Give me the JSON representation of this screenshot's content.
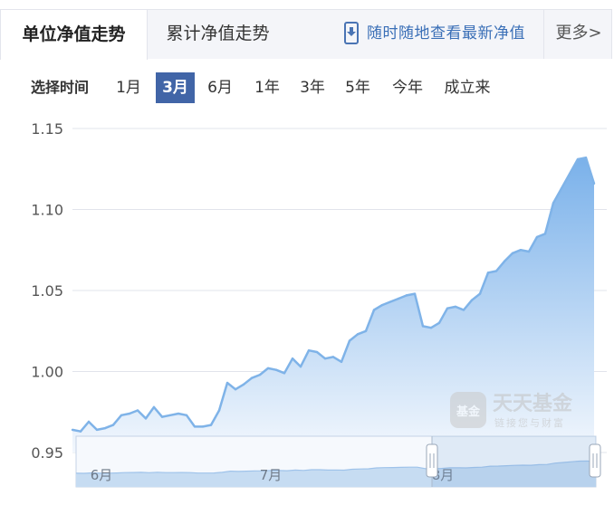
{
  "tabs": {
    "unit_nav": "单位净值走势",
    "cumulative_nav": "累计净值走势",
    "mobile_link": "随时随地查看最新净值",
    "more": "更多>"
  },
  "range": {
    "label": "选择时间",
    "options": [
      "1月",
      "3月",
      "6月",
      "1年",
      "3年",
      "5年",
      "今年",
      "成立来"
    ],
    "selected": "3月"
  },
  "watermark": {
    "brand": "天天基金",
    "slogan": "链接您与财富",
    "logo_text": "基金"
  },
  "colors": {
    "accent": "#4165a7",
    "line": "#7fb3e8",
    "area_top": "#7ab1ea",
    "area_bottom": "#f2f7fd"
  },
  "chart_data": {
    "type": "area",
    "y_ticks": [
      "1.15",
      "1.10",
      "1.05",
      "1.00",
      "0.95"
    ],
    "ylim": [
      0.95,
      1.15
    ],
    "grid": true,
    "x": [
      "2024-05-27",
      "2024-05-28",
      "2024-05-29",
      "2024-05-30",
      "2024-05-31",
      "2024-06-03",
      "2024-06-04",
      "2024-06-05",
      "2024-06-06",
      "2024-06-07",
      "2024-06-11",
      "2024-06-12",
      "2024-06-13",
      "2024-06-14",
      "2024-06-17",
      "2024-06-18",
      "2024-06-19",
      "2024-06-20",
      "2024-06-21",
      "2024-06-24",
      "2024-06-25",
      "2024-06-26",
      "2024-06-27",
      "2024-06-28",
      "2024-07-01",
      "2024-07-02",
      "2024-07-03",
      "2024-07-04",
      "2024-07-05",
      "2024-07-08",
      "2024-07-09",
      "2024-07-10",
      "2024-07-11",
      "2024-07-12",
      "2024-07-15",
      "2024-07-16",
      "2024-07-17",
      "2024-07-18",
      "2024-07-19",
      "2024-07-22",
      "2024-07-23",
      "2024-07-24",
      "2024-07-25",
      "2024-07-26",
      "2024-07-29",
      "2024-07-30",
      "2024-07-31",
      "2024-08-01",
      "2024-08-02",
      "2024-08-05",
      "2024-08-06",
      "2024-08-07",
      "2024-08-08",
      "2024-08-09",
      "2024-08-12",
      "2024-08-13",
      "2024-08-14",
      "2024-08-15",
      "2024-08-16",
      "2024-08-19",
      "2024-08-20",
      "2024-08-21",
      "2024-08-22",
      "2024-08-23",
      "2024-08-26"
    ],
    "values": [
      0.964,
      0.963,
      0.969,
      0.964,
      0.965,
      0.967,
      0.973,
      0.974,
      0.976,
      0.971,
      0.978,
      0.972,
      0.973,
      0.974,
      0.973,
      0.966,
      0.966,
      0.967,
      0.976,
      0.993,
      0.989,
      0.992,
      0.996,
      0.998,
      1.002,
      1.001,
      0.999,
      1.008,
      1.003,
      1.013,
      1.012,
      1.008,
      1.009,
      1.006,
      1.019,
      1.023,
      1.025,
      1.038,
      1.041,
      1.043,
      1.045,
      1.047,
      1.048,
      1.028,
      1.027,
      1.03,
      1.039,
      1.04,
      1.038,
      1.044,
      1.048,
      1.061,
      1.062,
      1.068,
      1.073,
      1.075,
      1.074,
      1.083,
      1.085,
      1.104,
      1.113,
      1.122,
      1.131,
      1.132,
      1.116
    ],
    "x_ticks": [
      "6月",
      "7月",
      "8月"
    ]
  }
}
